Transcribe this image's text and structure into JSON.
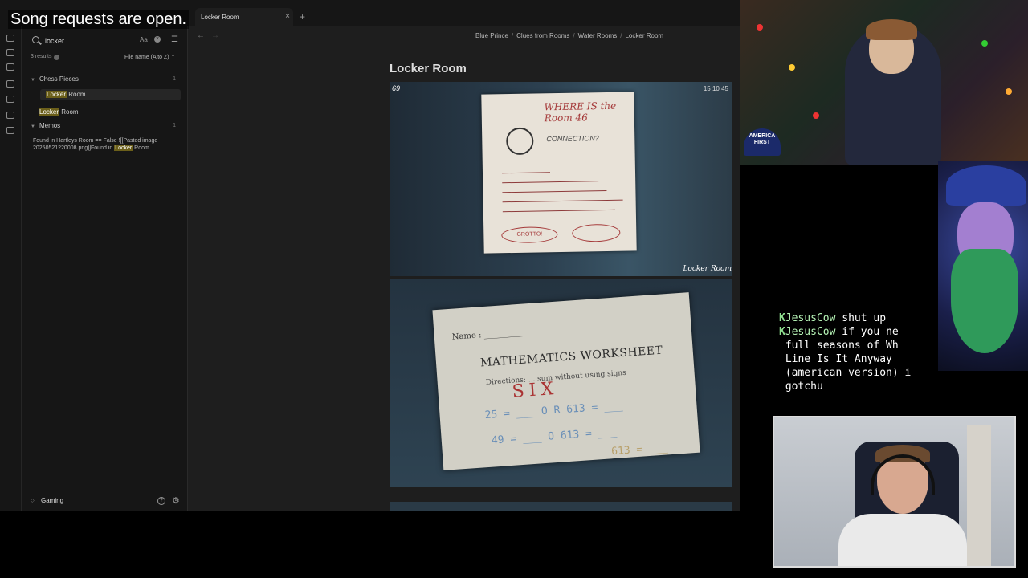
{
  "overlay": {
    "banner": "Song requests are open."
  },
  "tabs": [
    {
      "label": "Locker Room",
      "close": "×"
    }
  ],
  "new_tab": "+",
  "search": {
    "query": "locker",
    "match_case": "Aa",
    "clear": "×",
    "filter": "☰",
    "results_count": "3 results",
    "sort": "File name (A to Z) ⌃"
  },
  "results": {
    "groups": [
      {
        "label": "Chess Pieces",
        "count": "1"
      },
      {
        "label": "Memos",
        "count": "1"
      }
    ],
    "items": [
      {
        "match": "Locker",
        "rest": " Room"
      },
      {
        "match": "Locker",
        "rest": " Room"
      }
    ],
    "memo_text_1": "Found in Hartleys Room == False ![[Pasted image 20250521220008.png]]Found in ",
    "memo_match": "Locker",
    "memo_text_2": " Room"
  },
  "vault": {
    "name": "Gaming"
  },
  "nav": {
    "back": "←",
    "forward": "→"
  },
  "breadcrumb": [
    "Blue Prince",
    "Clues from Rooms",
    "Water Rooms",
    "Locker Room"
  ],
  "breadcrumb_sep": "/",
  "note": {
    "title": "Locker Room"
  },
  "image1": {
    "hud_left": "69",
    "hud_right": "15   10   45",
    "heading": "WHERE IS the  Room 46",
    "connection": "CONNECTION?",
    "grotto": "GROTTO!",
    "caption": "Locker Room"
  },
  "image2": {
    "name_label": "Name : ___________",
    "title": "MATHEMATICS WORKSHEET",
    "directions": "Directions: ... sum without using signs",
    "six": "SIX",
    "eqs": [
      "25 = ___ O   R  613 = ___",
      "49 = ___ O     613 = ___",
      "613 = ___"
    ]
  },
  "cam_top": {
    "hat_text": "AMERICA FIRST"
  },
  "chat": {
    "messages": [
      {
        "user": "JesusCow",
        "text": " shut up"
      },
      {
        "user": "JesusCow",
        "text": " if you ne"
      },
      {
        "user": "",
        "text": " full seasons of Wh"
      },
      {
        "user": "",
        "text": " Line Is It Anyway"
      },
      {
        "user": "",
        "text": " (american version) i"
      },
      {
        "user": "",
        "text": " gotchu"
      }
    ],
    "badge": "K"
  },
  "colors": {
    "accent": "#6b5f1a",
    "panel": "#161616",
    "editor": "#1e1e1e"
  }
}
